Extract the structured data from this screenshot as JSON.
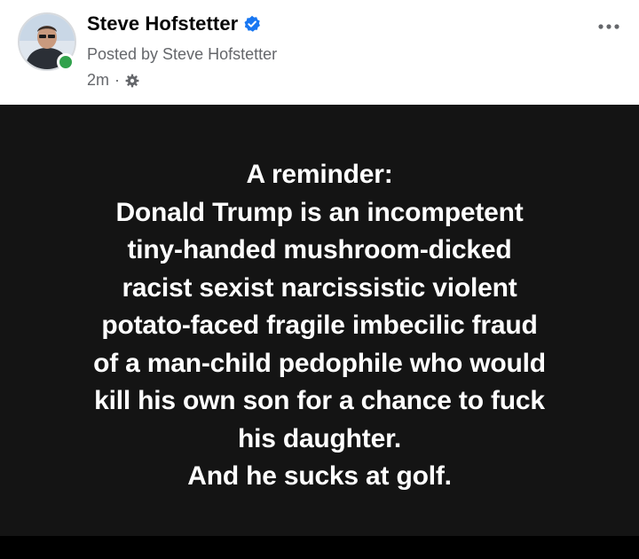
{
  "post": {
    "author_name": "Steve Hofstetter",
    "posted_by": "Posted by Steve Hofstetter",
    "time": "2m",
    "separator": "·",
    "audience_icon": "gear-icon",
    "verified_icon": "verified-badge-icon",
    "more_icon": "more-options-icon",
    "colors": {
      "verified": "#1877f2",
      "online": "#31a24c",
      "secondary_text": "#65676b",
      "body_background": "#141414",
      "body_text": "#ffffff"
    }
  },
  "content": {
    "lines": [
      "A reminder:",
      "Donald Trump is an incompetent",
      "tiny-handed mushroom-dicked",
      "racist sexist narcissistic violent",
      "potato-faced fragile imbecilic fraud",
      "of a man-child pedophile who would",
      "kill his own son for a chance to fuck",
      "his daughter.",
      "And he sucks at golf."
    ]
  }
}
